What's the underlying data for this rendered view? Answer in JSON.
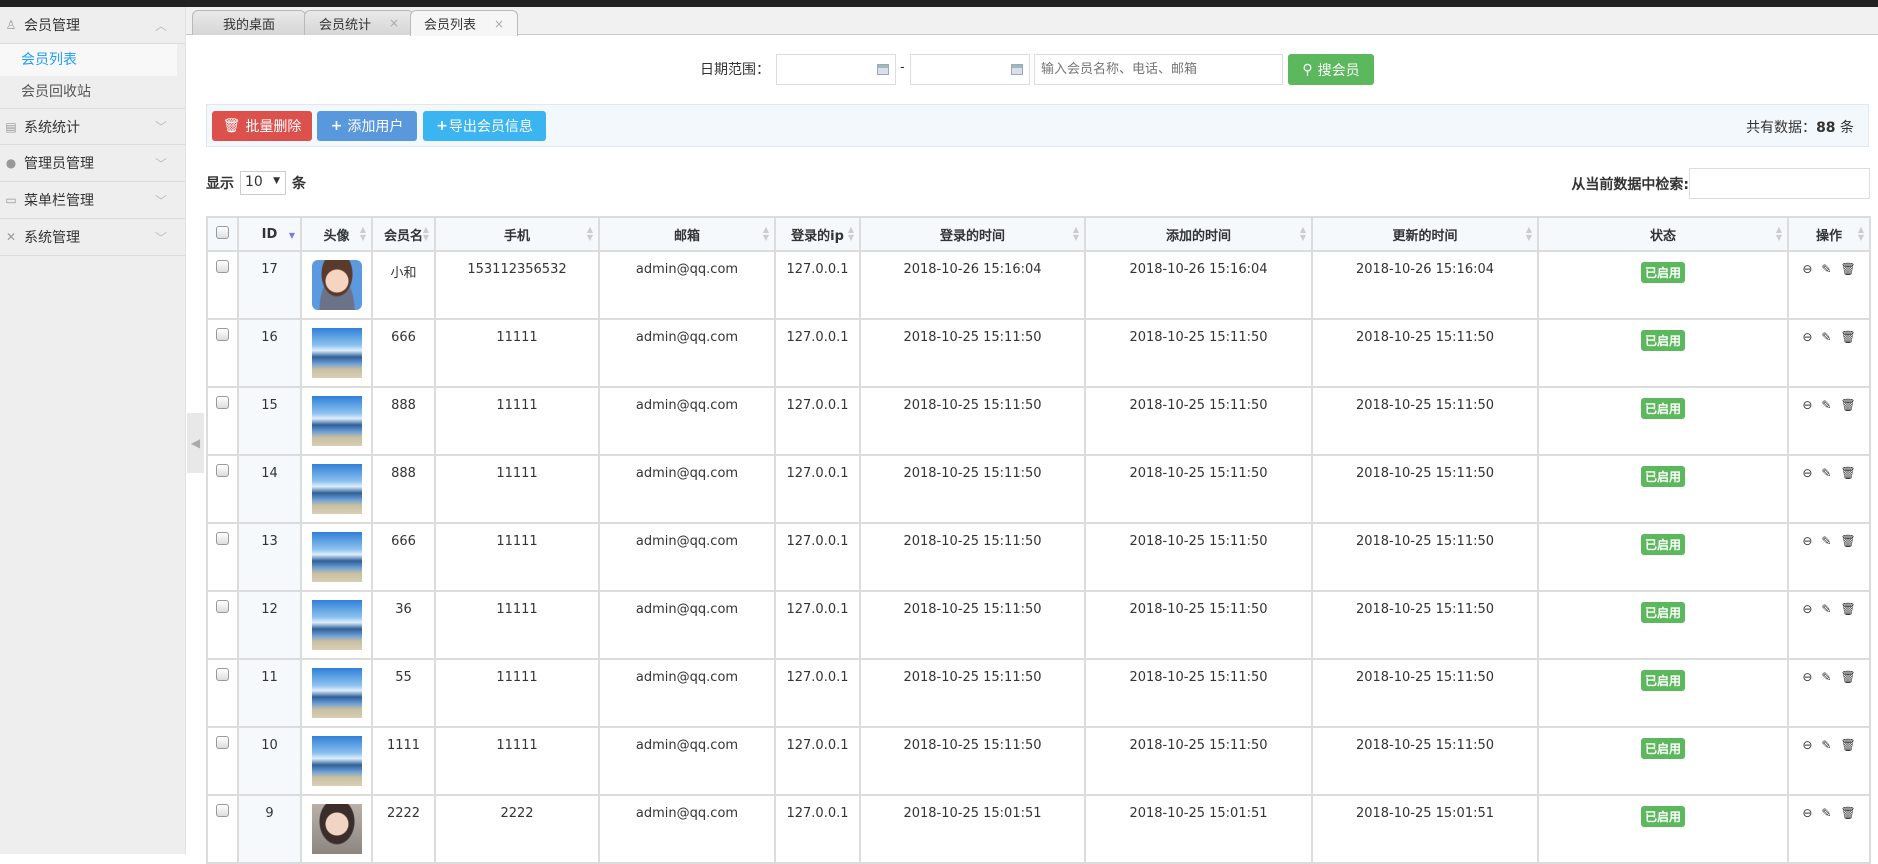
{
  "sidebar": {
    "groups": [
      {
        "label": "会员管理",
        "icon": "user-badge-icon",
        "expanded": true,
        "items": [
          {
            "label": "会员列表",
            "active": true
          },
          {
            "label": "会员回收站"
          }
        ]
      },
      {
        "label": "系统统计",
        "icon": "chart-icon"
      },
      {
        "label": "管理员管理",
        "icon": "person-icon"
      },
      {
        "label": "菜单栏管理",
        "icon": "window-icon"
      },
      {
        "label": "系统管理",
        "icon": "tools-icon"
      }
    ]
  },
  "tabs": [
    {
      "label": "我的桌面"
    },
    {
      "label": "会员统计",
      "close": "×"
    },
    {
      "label": "会员列表",
      "close": "×",
      "active": true
    }
  ],
  "search": {
    "date_label": "日期范围：",
    "dash": "-",
    "start_value": "",
    "end_value": "",
    "keyword_placeholder": "输入会员名称、电话、邮箱",
    "button": "搜会员"
  },
  "toolbar": {
    "batch_delete": "批量删除",
    "add_user": "添加用户",
    "export": "导出会员信息",
    "count_prefix": "共有数据：",
    "count": "88",
    "count_suffix": "条"
  },
  "length": {
    "prefix": "显示",
    "value": "10",
    "suffix": "条"
  },
  "filter": {
    "label": "从当前数据中检索:",
    "value": ""
  },
  "table": {
    "headers": [
      "ID",
      "头像",
      "会员名",
      "手机",
      "邮箱",
      "登录的ip",
      "登录的时间",
      "添加的时间",
      "更新的时间",
      "状态",
      "操作"
    ],
    "rows": [
      {
        "id": "17",
        "avatar": "cartoon",
        "name": "小和",
        "phone": "153112356532",
        "email": "admin@qq.com",
        "ip": "127.0.0.1",
        "login": "2018-10-26 15:16:04",
        "added": "2018-10-26 15:16:04",
        "updated": "2018-10-26 15:16:04",
        "status": "已启用"
      },
      {
        "id": "16",
        "avatar": "lake",
        "name": "666",
        "phone": "11111",
        "email": "admin@qq.com",
        "ip": "127.0.0.1",
        "login": "2018-10-25 15:11:50",
        "added": "2018-10-25 15:11:50",
        "updated": "2018-10-25 15:11:50",
        "status": "已启用"
      },
      {
        "id": "15",
        "avatar": "lake",
        "name": "888",
        "phone": "11111",
        "email": "admin@qq.com",
        "ip": "127.0.0.1",
        "login": "2018-10-25 15:11:50",
        "added": "2018-10-25 15:11:50",
        "updated": "2018-10-25 15:11:50",
        "status": "已启用"
      },
      {
        "id": "14",
        "avatar": "lake",
        "name": "888",
        "phone": "11111",
        "email": "admin@qq.com",
        "ip": "127.0.0.1",
        "login": "2018-10-25 15:11:50",
        "added": "2018-10-25 15:11:50",
        "updated": "2018-10-25 15:11:50",
        "status": "已启用"
      },
      {
        "id": "13",
        "avatar": "lake",
        "name": "666",
        "phone": "11111",
        "email": "admin@qq.com",
        "ip": "127.0.0.1",
        "login": "2018-10-25 15:11:50",
        "added": "2018-10-25 15:11:50",
        "updated": "2018-10-25 15:11:50",
        "status": "已启用"
      },
      {
        "id": "12",
        "avatar": "lake",
        "name": "36",
        "phone": "11111",
        "email": "admin@qq.com",
        "ip": "127.0.0.1",
        "login": "2018-10-25 15:11:50",
        "added": "2018-10-25 15:11:50",
        "updated": "2018-10-25 15:11:50",
        "status": "已启用"
      },
      {
        "id": "11",
        "avatar": "lake",
        "name": "55",
        "phone": "11111",
        "email": "admin@qq.com",
        "ip": "127.0.0.1",
        "login": "2018-10-25 15:11:50",
        "added": "2018-10-25 15:11:50",
        "updated": "2018-10-25 15:11:50",
        "status": "已启用"
      },
      {
        "id": "10",
        "avatar": "lake",
        "name": "1111",
        "phone": "11111",
        "email": "admin@qq.com",
        "ip": "127.0.0.1",
        "login": "2018-10-25 15:11:50",
        "added": "2018-10-25 15:11:50",
        "updated": "2018-10-25 15:11:50",
        "status": "已启用"
      },
      {
        "id": "9",
        "avatar": "portrait",
        "name": "2222",
        "phone": "2222",
        "email": "admin@qq.com",
        "ip": "127.0.0.1",
        "login": "2018-10-25 15:01:51",
        "added": "2018-10-25 15:01:51",
        "updated": "2018-10-25 15:01:51",
        "status": "已启用"
      }
    ]
  },
  "colors": {
    "danger": "#dd514c",
    "primary": "#5a98de",
    "info": "#3bb4f2",
    "success": "#5cb85c",
    "link": "#1e9fff"
  }
}
